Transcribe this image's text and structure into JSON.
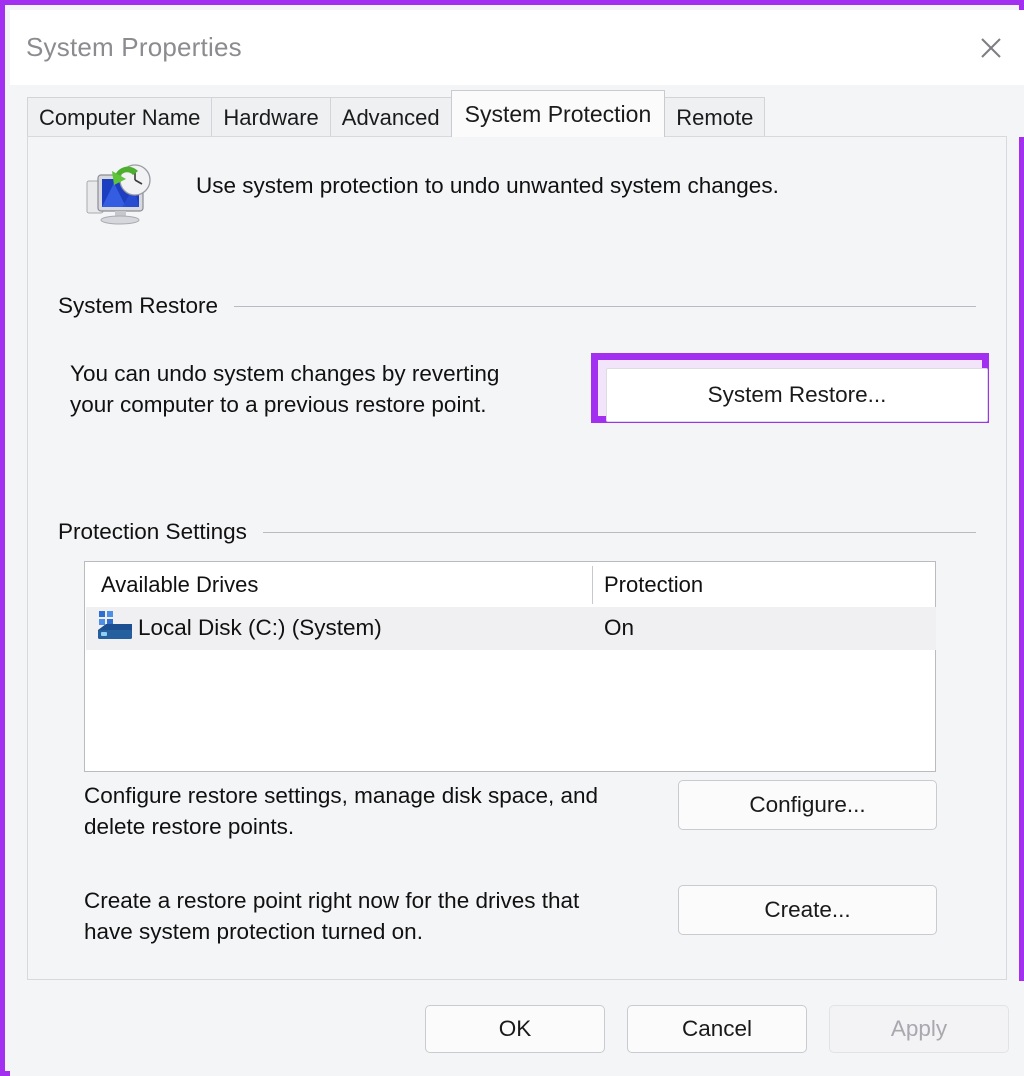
{
  "window": {
    "title": "System Properties",
    "close_icon": "close-icon",
    "highlight_color": "#a32ff0",
    "background": "#f4f5f7"
  },
  "tabs": [
    {
      "label": "Computer Name",
      "active": false
    },
    {
      "label": "Hardware",
      "active": false
    },
    {
      "label": "Advanced",
      "active": false
    },
    {
      "label": "System Protection",
      "active": true
    },
    {
      "label": "Remote",
      "active": false
    }
  ],
  "header": {
    "icon": "system-restore-icon",
    "description": "Use system protection to undo unwanted system changes."
  },
  "system_restore": {
    "group_label": "System Restore",
    "description_line1": "You can undo system changes by reverting",
    "description_line2": "your computer to a previous restore point.",
    "button_label": "System Restore...",
    "button_highlighted": true
  },
  "protection_settings": {
    "group_label": "Protection Settings",
    "table": {
      "columns": [
        "Available Drives",
        "Protection"
      ],
      "rows": [
        {
          "drive_icon": "hard-drive-icon",
          "drive": "Local Disk (C:) (System)",
          "protection": "On",
          "selected": true
        }
      ]
    },
    "configure": {
      "description_line1": "Configure restore settings, manage disk space, and",
      "description_line2": "delete restore points.",
      "button_label": "Configure..."
    },
    "create": {
      "description_line1": "Create a restore point right now for the drives that",
      "description_line2": "have system protection turned on.",
      "button_label": "Create..."
    }
  },
  "footer": {
    "ok_label": "OK",
    "cancel_label": "Cancel",
    "apply_label": "Apply",
    "apply_enabled": false
  }
}
